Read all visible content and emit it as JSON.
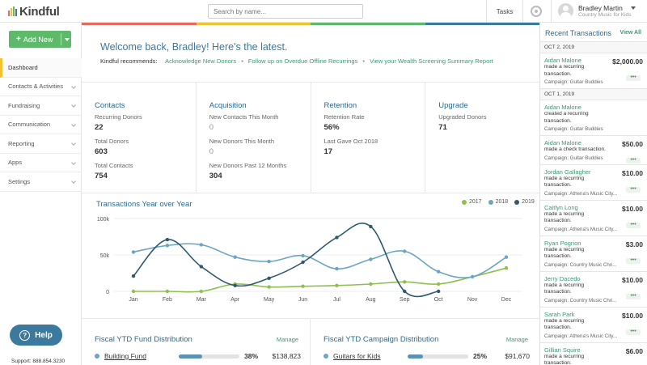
{
  "app": {
    "logo_text": "Kindful",
    "brand_colors": [
      "#e56b5c",
      "#f1c232",
      "#5fb96a",
      "#3a7aa0"
    ]
  },
  "topbar": {
    "search_placeholder": "Search by name...",
    "tasks_label": "Tasks",
    "user_name": "Bradley Martin",
    "user_org": "Country Music for Kids"
  },
  "sidebar": {
    "add_new_label": "Add New",
    "items": [
      {
        "label": "Dashboard",
        "active": true
      },
      {
        "label": "Contacts & Activities"
      },
      {
        "label": "Fundraising"
      },
      {
        "label": "Communication"
      },
      {
        "label": "Reporting"
      },
      {
        "label": "Apps"
      },
      {
        "label": "Settings"
      }
    ],
    "help_label": "Help",
    "support_text": "Support: 888.854.3230"
  },
  "main": {
    "welcome": "Welcome back, Bradley! Here's the latest.",
    "recommends_label": "Kindful recommends:",
    "recommendations": [
      "Acknowledge New Donors",
      "Follow up on Overdue Offline Recurrings",
      "View your Wealth Screening Summary Report"
    ],
    "stats": [
      {
        "title": "Contacts",
        "items": [
          {
            "label": "Recurring Donors",
            "value": "22"
          },
          {
            "label": "Total Donors",
            "value": "603"
          },
          {
            "label": "Total Contacts",
            "value": "754"
          }
        ]
      },
      {
        "title": "Acquisition",
        "items": [
          {
            "label": "New Contacts This Month",
            "value": "0"
          },
          {
            "label": "New Donors This Month",
            "value": "0"
          },
          {
            "label": "New Donors Past 12 Months",
            "value": "304"
          }
        ]
      },
      {
        "title": "Retention",
        "items": [
          {
            "label": "Retention Rate",
            "value": "56%"
          },
          {
            "label": "Last Gave Oct 2018",
            "value": "17"
          }
        ]
      },
      {
        "title": "Upgrade",
        "items": [
          {
            "label": "Upgraded Donors",
            "value": "71"
          }
        ]
      }
    ],
    "fund_distribution": {
      "title": "Fiscal YTD Fund Distribution",
      "manage_label": "Manage",
      "name": "Building Fund",
      "percent": "38%",
      "fraction": 0.38,
      "amount": "$138,823"
    },
    "campaign_distribution": {
      "title": "Fiscal YTD Campaign Distribution",
      "manage_label": "Manage",
      "name": "Guitars for Kids",
      "percent": "25%",
      "fraction": 0.25,
      "amount": "$91,670"
    }
  },
  "chart_data": {
    "type": "line",
    "title": "Transactions Year over Year",
    "categories": [
      "Jan",
      "Feb",
      "Mar",
      "Apr",
      "May",
      "Jun",
      "Jul",
      "Aug",
      "Sep",
      "Oct",
      "Nov",
      "Dec"
    ],
    "y_ticks": [
      "100k",
      "50k",
      "0"
    ],
    "ylim": [
      0,
      100000
    ],
    "legend_position": "top-right",
    "grid": true,
    "series": [
      {
        "name": "2017",
        "color": "#8dc04f",
        "values": [
          0,
          0,
          0,
          10000,
          6000,
          7000,
          8000,
          10000,
          13000,
          10000,
          20000,
          32000
        ]
      },
      {
        "name": "2018",
        "color": "#6aa6c4",
        "values": [
          54000,
          63000,
          64000,
          47000,
          41000,
          49000,
          31000,
          44000,
          55000,
          27000,
          20000,
          47000
        ]
      },
      {
        "name": "2019",
        "color": "#2e5a6e",
        "values": [
          21000,
          71000,
          34000,
          8000,
          18000,
          40000,
          74000,
          89000,
          0,
          0,
          null,
          null
        ]
      }
    ]
  },
  "transactions": {
    "title": "Recent Transactions",
    "view_all_label": "View All",
    "groups": [
      {
        "date": "OCT 2, 2019",
        "items": [
          {
            "name": "Aidan Malone",
            "desc": "made a recurring transaction.",
            "campaign": "Campaign: Guitar Buddies",
            "amount": "$2,000.00"
          }
        ]
      },
      {
        "date": "OCT 1, 2019",
        "items": [
          {
            "name": "Aidan Malone",
            "desc": "created a recurring transaction.",
            "campaign": "Campaign: Guitar Buddies",
            "amount": ""
          },
          {
            "name": "Aidan Malone",
            "desc": "made a check transaction.",
            "campaign": "Campaign: Guitar Buddies",
            "amount": "$50.00"
          },
          {
            "name": "Jordan Gallagher",
            "desc": "made a recurring transaction.",
            "campaign": "Campaign: Athena's Music City...",
            "amount": "$10.00"
          },
          {
            "name": "Caitlyn Long",
            "desc": "made a recurring transaction.",
            "campaign": "Campaign: Athena's Music City...",
            "amount": "$10.00"
          },
          {
            "name": "Ryan Pogrion",
            "desc": "made a recurring transaction.",
            "campaign": "Campaign: Country Music Chri...",
            "amount": "$3.00"
          },
          {
            "name": "Jerry Dacedo",
            "desc": "made a recurring transaction.",
            "campaign": "Campaign: Country Music Chri...",
            "amount": "$10.00"
          },
          {
            "name": "Sarah Park",
            "desc": "made a recurring transaction.",
            "campaign": "Campaign: Athena's Music City...",
            "amount": "$10.00"
          },
          {
            "name": "Gillian Squire",
            "desc": "made a recurring transaction.",
            "campaign": "",
            "amount": "$6.00"
          }
        ]
      }
    ]
  }
}
